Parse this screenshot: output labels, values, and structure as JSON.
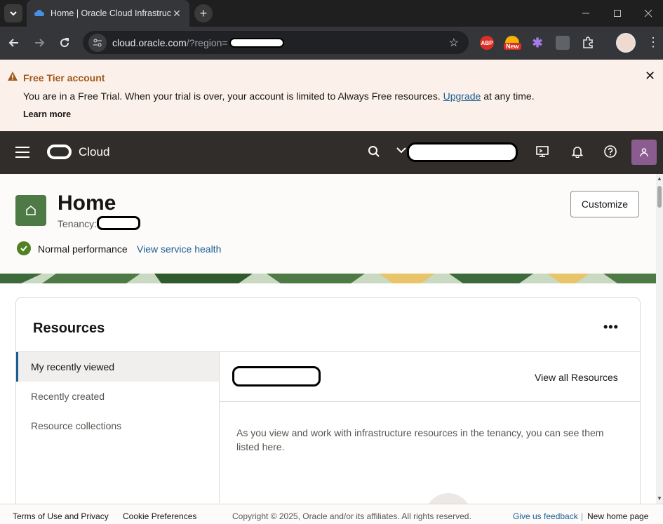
{
  "browser": {
    "tab_title": "Home | Oracle Cloud Infrastructure",
    "url_host": "cloud.oracle.com",
    "url_path": "/?region=",
    "new_tab_symbol": "+",
    "close_symbol": "✕",
    "ext_abp": "ABP",
    "ext_new_badge": "New"
  },
  "banner": {
    "title": "Free Tier account",
    "text_before": "You are in a Free Trial. When your trial is over, your account is limited to Always Free resources. ",
    "link": "Upgrade",
    "text_after": " at any time.",
    "learn_more": "Learn more",
    "accent": "#a1581a"
  },
  "header": {
    "product": "Cloud",
    "bg": "#312d2a"
  },
  "home": {
    "title": "Home",
    "tenancy_label": "Tenancy:",
    "status": "Normal performance",
    "status_link": "View service health",
    "customize": "Customize"
  },
  "resources": {
    "title": "Resources",
    "more": "•••",
    "nav": [
      {
        "label": "My recently viewed"
      },
      {
        "label": "Recently created"
      },
      {
        "label": "Resource collections"
      }
    ],
    "view_all": "View all Resources",
    "description": "As you view and work with infrastructure resources in the tenancy, you can see them listed here."
  },
  "footer": {
    "terms": "Terms of Use and Privacy",
    "cookies": "Cookie Preferences",
    "copyright": "Copyright © 2025, Oracle and/or its affiliates. All rights reserved.",
    "feedback": "Give us feedback",
    "separator": "|",
    "new_home": "New home page"
  }
}
